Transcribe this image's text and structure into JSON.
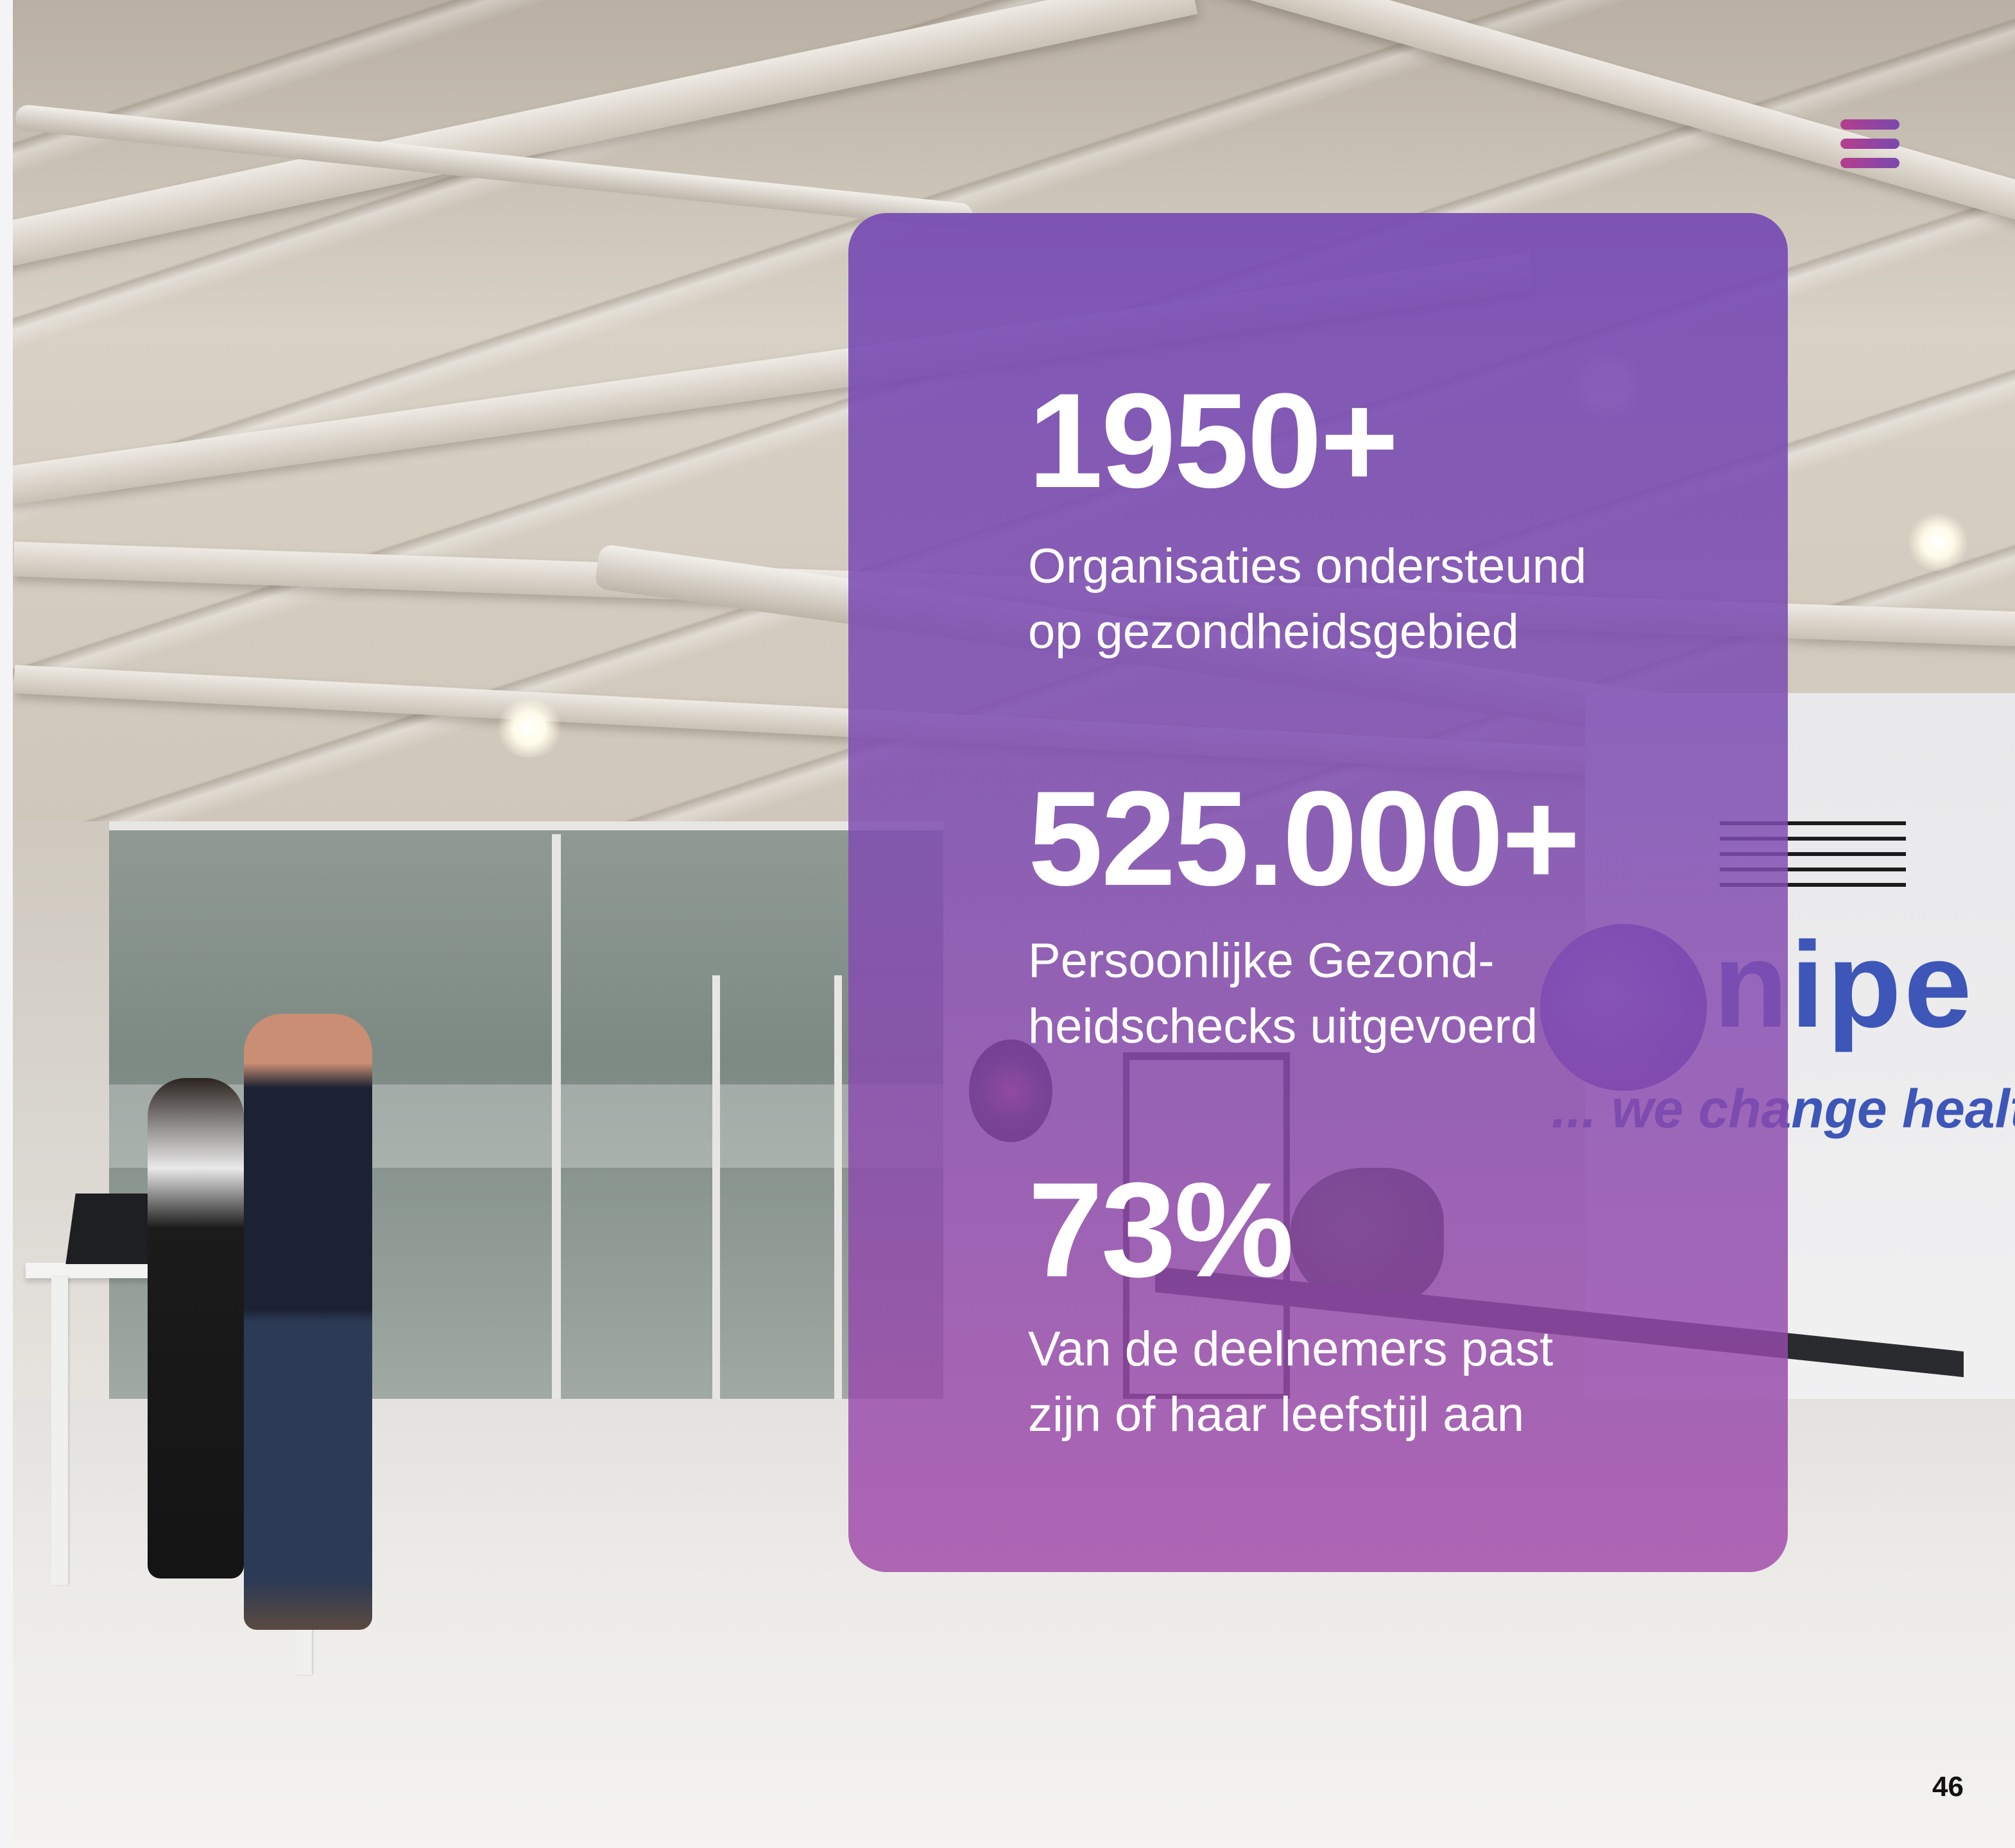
{
  "navigation": {
    "menu_icon": "hamburger-menu-icon",
    "menu_color_start": "#b53e8d",
    "menu_color_end": "#7a48b0"
  },
  "background": {
    "photo": "office-interior-photo",
    "wall_logo": {
      "brand": "nipe",
      "tagline": "... we change healt"
    }
  },
  "stats_card": {
    "color": "#7e4cb2",
    "stats": [
      {
        "value": "1950+",
        "label_line1": "Organisaties ondersteund",
        "label_line2": "op gezondheidsgebied"
      },
      {
        "value": "525.000+",
        "label_line1": "Persoonlijke Gezond-",
        "label_line2": "heidschecks uitgevoerd"
      },
      {
        "value": "73%",
        "label_line1": "Van de deelnemers past",
        "label_line2": "zijn of haar leefstijl aan"
      }
    ]
  },
  "footer": {
    "page_number": "46"
  }
}
